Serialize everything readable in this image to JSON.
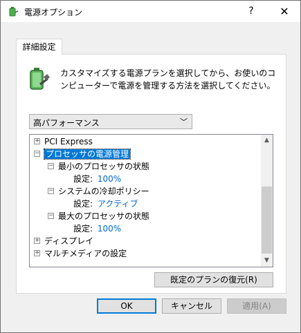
{
  "window": {
    "title": "電源オプション",
    "help_label": "?",
    "close_label": "✕"
  },
  "tab": {
    "label": "詳細設定"
  },
  "description": "カスタマイズする電源プランを選択してから、お使いのコンピューターで電源を管理する方法を選択してください。",
  "plan_select": {
    "value": "高パフォーマンス"
  },
  "tree": {
    "items": [
      {
        "expander": "+",
        "label": "PCI Express"
      },
      {
        "expander": "−",
        "label": "プロセッサの電源管理",
        "selected": true
      },
      {
        "expander": "−",
        "label": "最小のプロセッサの状態"
      },
      {
        "label_prefix": "設定:",
        "value": "100%"
      },
      {
        "expander": "−",
        "label": "システムの冷却ポリシー"
      },
      {
        "label_prefix": "設定:",
        "value": "アクティブ"
      },
      {
        "expander": "−",
        "label": "最大のプロセッサの状態"
      },
      {
        "label_prefix": "設定:",
        "value": "100%"
      },
      {
        "expander": "+",
        "label": "ディスプレイ"
      },
      {
        "expander": "+",
        "label": "マルチメディアの設定"
      }
    ]
  },
  "buttons": {
    "restore": "既定のプランの復元(R)",
    "ok": "OK",
    "cancel": "キャンセル",
    "apply": "適用(A)"
  },
  "colors": {
    "selection": "#0078d7",
    "setting_value": "#0066cc",
    "default_button_border": "#0078d7"
  }
}
